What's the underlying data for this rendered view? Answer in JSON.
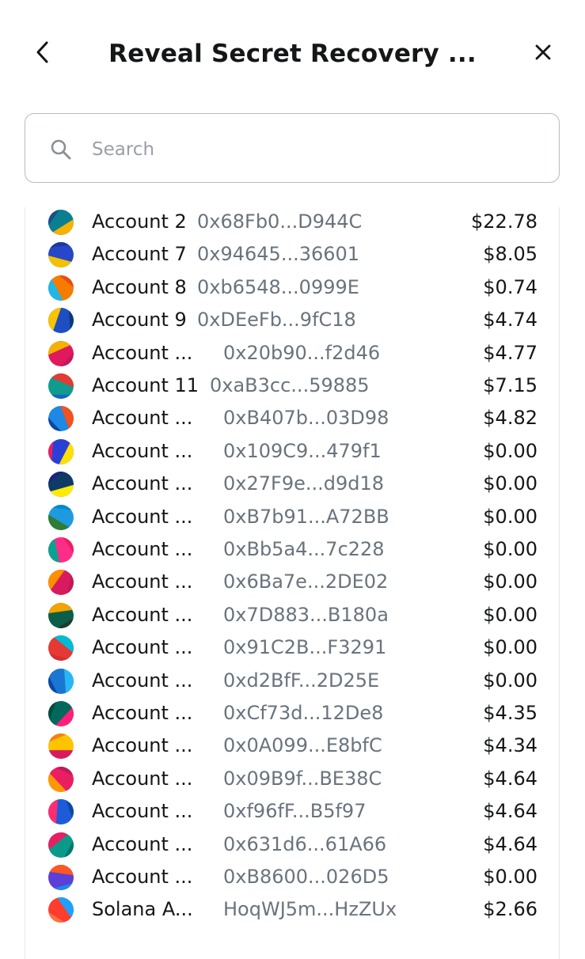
{
  "header": {
    "title": "Reveal Secret Recovery ...",
    "back_icon": "chevron-left-icon",
    "close_icon": "close-icon"
  },
  "search": {
    "placeholder": "Search",
    "value": "",
    "icon": "search-icon"
  },
  "accounts": [
    {
      "name": "Account 2",
      "address": "0x68Fb0...D944C",
      "balance": "$22.78",
      "colors": [
        "#0b7f8f",
        "#f5b300",
        "#1c4e8a"
      ]
    },
    {
      "name": "Account 7",
      "address": "0x94645...36601",
      "balance": "$8.05",
      "colors": [
        "#2747c8",
        "#f2c200",
        "#1b3a9e"
      ]
    },
    {
      "name": "Account 8",
      "address": "0xb6548...0999E",
      "balance": "$0.74",
      "colors": [
        "#f57c00",
        "#1fb6e8",
        "#e84a1a"
      ]
    },
    {
      "name": "Account 9",
      "address": "0xDEeFb...9fC18",
      "balance": "$4.74",
      "colors": [
        "#1d4fc2",
        "#f7c400",
        "#0c3a73"
      ]
    },
    {
      "name": "Account ...",
      "address": "0x20b90...f2d46",
      "balance": "$4.77",
      "colors": [
        "#e0195c",
        "#f5b100",
        "#c2185b"
      ]
    },
    {
      "name": "Account 11",
      "address": "0xaB3cc...59885",
      "balance": "$7.15",
      "colors": [
        "#0f9b8e",
        "#e53935",
        "#1565c0"
      ]
    },
    {
      "name": "Account ...",
      "address": "0xB407b...03D98",
      "balance": "$4.82",
      "colors": [
        "#1e88e5",
        "#f4511e",
        "#0d47a1"
      ]
    },
    {
      "name": "Account ...",
      "address": "0x109C9...479f1",
      "balance": "$0.00",
      "colors": [
        "#2a3fd6",
        "#ffe000",
        "#e91e63"
      ]
    },
    {
      "name": "Account ...",
      "address": "0x27F9e...d9d18",
      "balance": "$0.00",
      "colors": [
        "#0d3b66",
        "#ffeb00",
        "#1a237e"
      ]
    },
    {
      "name": "Account ...",
      "address": "0xB7b91...A72BB",
      "balance": "$0.00",
      "colors": [
        "#1e9be0",
        "#2e7d32",
        "#0288d1"
      ]
    },
    {
      "name": "Account ...",
      "address": "0xBb5a4...7c228",
      "balance": "$0.00",
      "colors": [
        "#ff2d87",
        "#0aa38f",
        "#e91e63"
      ]
    },
    {
      "name": "Account ...",
      "address": "0x6Ba7e...2DE02",
      "balance": "$0.00",
      "colors": [
        "#d81b60",
        "#ff8f00",
        "#c2185b"
      ]
    },
    {
      "name": "Account ...",
      "address": "0x7D883...B180a",
      "balance": "$0.00",
      "colors": [
        "#0b5e4a",
        "#f4a300",
        "#1b3c2f"
      ]
    },
    {
      "name": "Account ...",
      "address": "0x91C2B...F3291",
      "balance": "$0.00",
      "colors": [
        "#e53935",
        "#00bcd4",
        "#d32f2f"
      ]
    },
    {
      "name": "Account ...",
      "address": "0xd2BfF...2D25E",
      "balance": "$0.00",
      "colors": [
        "#1976d2",
        "#29b6f6",
        "#0d47a1"
      ]
    },
    {
      "name": "Account ...",
      "address": "0xCf73d...12De8",
      "balance": "$4.35",
      "colors": [
        "#00695c",
        "#ff1f7a",
        "#004d40"
      ]
    },
    {
      "name": "Account ...",
      "address": "0x0A099...E8bfC",
      "balance": "$4.34",
      "colors": [
        "#ffc400",
        "#d81b60",
        "#f57f17"
      ]
    },
    {
      "name": "Account ...",
      "address": "0x09B9f...BE38C",
      "balance": "$4.64",
      "colors": [
        "#e91e63",
        "#ff9800",
        "#c2185b"
      ]
    },
    {
      "name": "Account ...",
      "address": "0xf96fF...B5f97",
      "balance": "$4.64",
      "colors": [
        "#1e5bd8",
        "#ff2d6f",
        "#0d47a1"
      ]
    },
    {
      "name": "Account ...",
      "address": "0x631d6...61A66",
      "balance": "$4.64",
      "colors": [
        "#0a9a8a",
        "#e91e63",
        "#00796b"
      ]
    },
    {
      "name": "Account ...",
      "address": "0xB8600...026D5",
      "balance": "$0.00",
      "colors": [
        "#5b3fd6",
        "#ff5722",
        "#1e88e5"
      ]
    },
    {
      "name": "Solana A...",
      "address": "HoqWJ5m...HzZUx",
      "balance": "$2.66",
      "colors": [
        "#ff3d2e",
        "#1ea0ff",
        "#ff7043"
      ]
    }
  ]
}
